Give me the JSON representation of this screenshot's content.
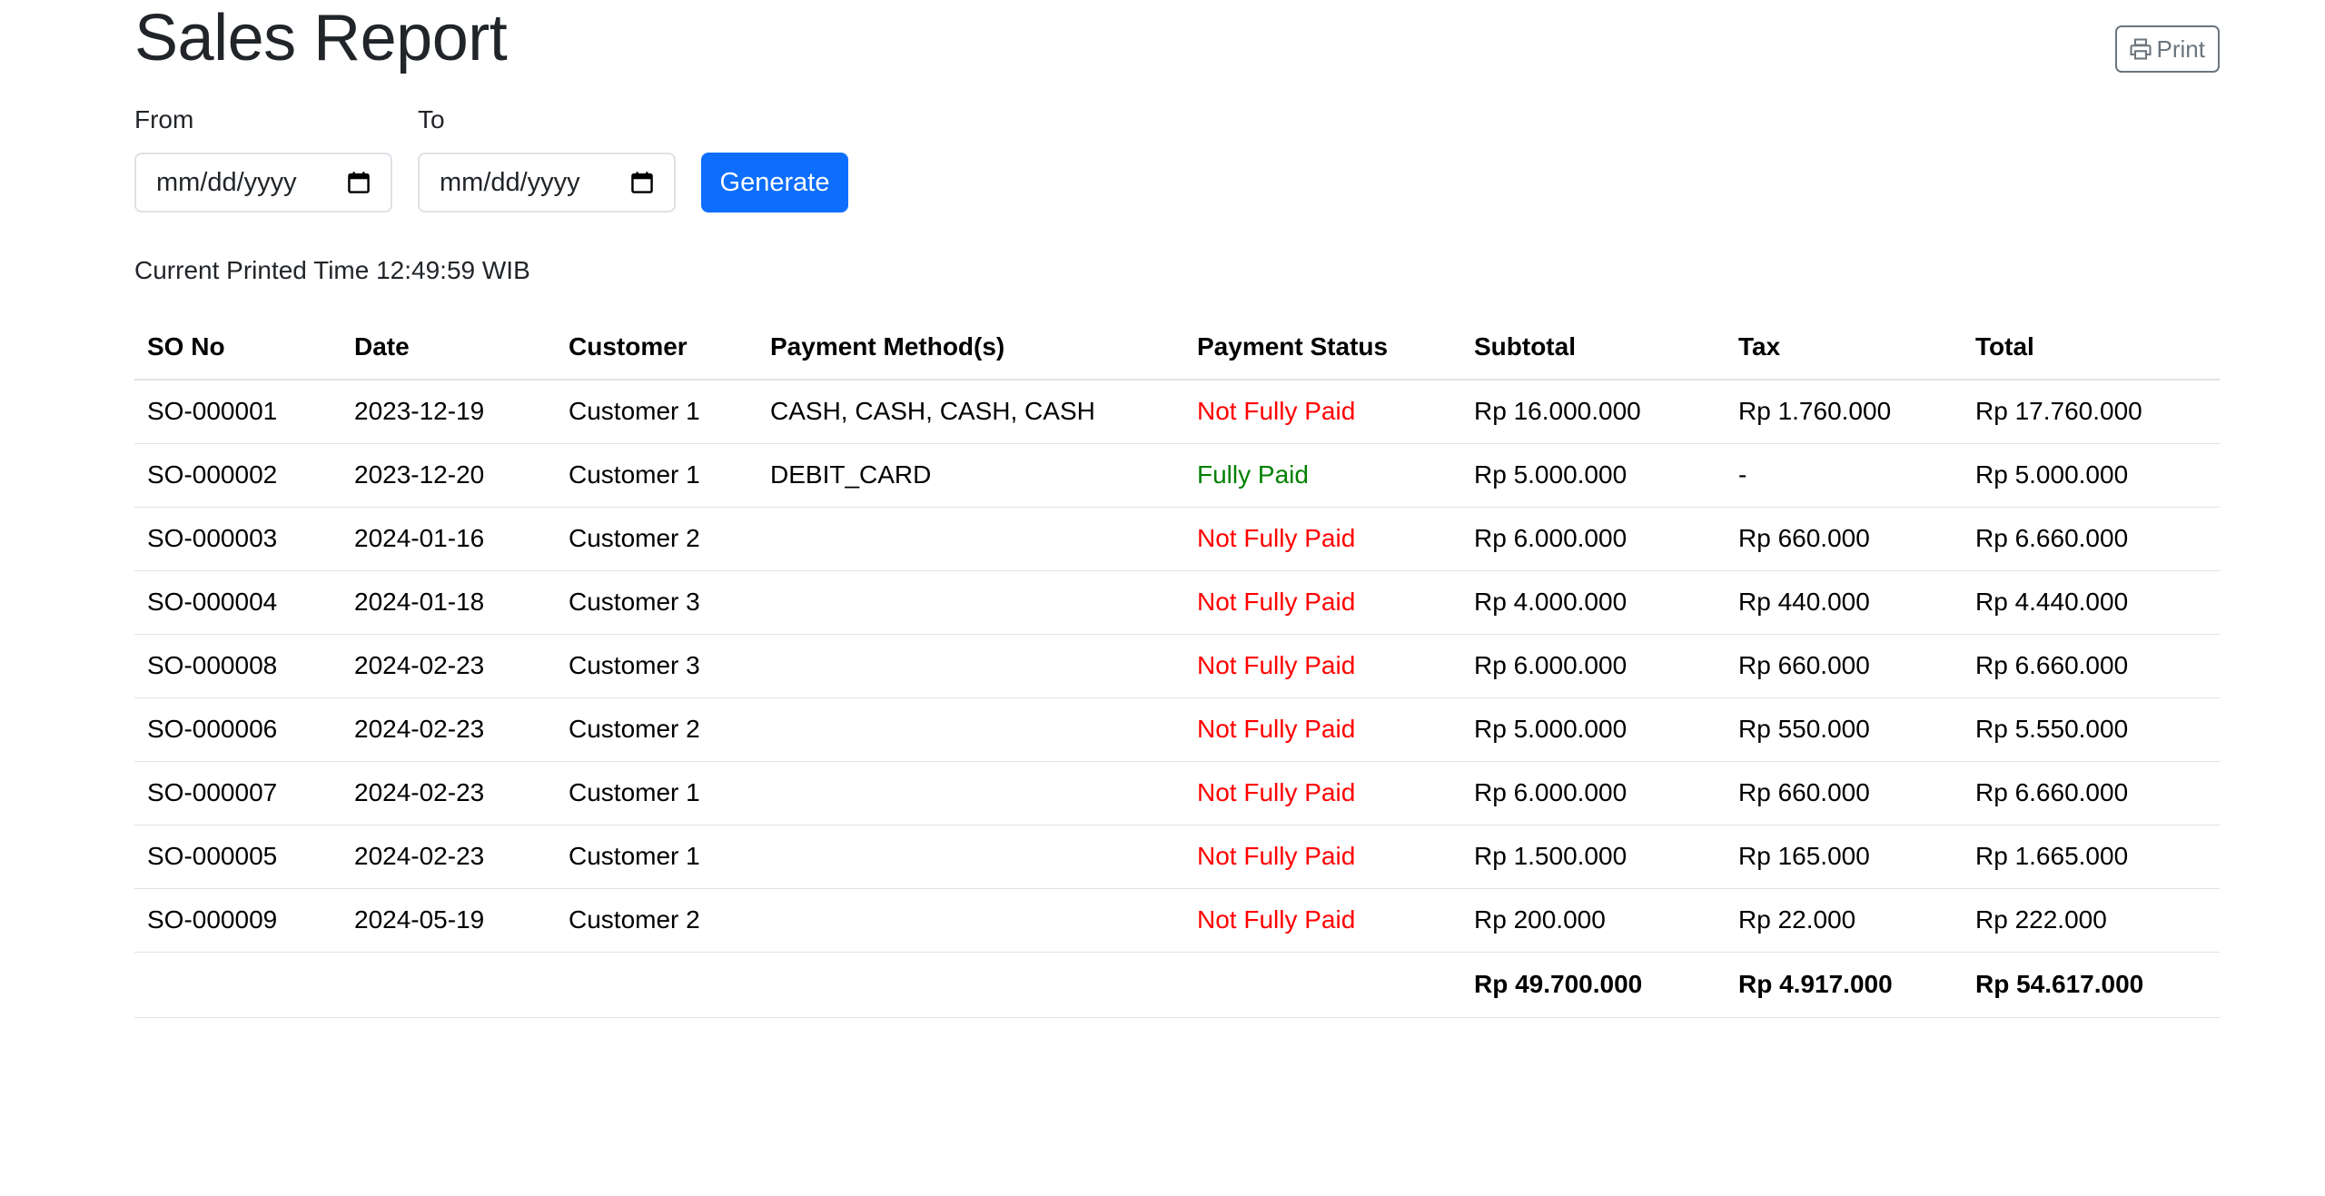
{
  "page": {
    "title": "Sales Report",
    "print_label": "Print"
  },
  "filters": {
    "from_label": "From",
    "to_label": "To",
    "from_placeholder": "mm/dd/yyyy",
    "to_placeholder": "mm/dd/yyyy",
    "generate_label": "Generate"
  },
  "printed_time": "Current Printed Time 12:49:59 WIB",
  "colors": {
    "primary": "#0d6efd",
    "not_fully_paid": "#ff0000",
    "fully_paid": "#008000",
    "secondary": "#6c757d"
  },
  "table": {
    "headers": [
      "SO No",
      "Date",
      "Customer",
      "Payment Method(s)",
      "Payment Status",
      "Subtotal",
      "Tax",
      "Total"
    ],
    "rows": [
      {
        "so_no": "SO-000001",
        "date": "2023-12-19",
        "customer": "Customer 1",
        "payment_methods": "CASH, CASH, CASH, CASH",
        "status": "Not Fully Paid",
        "subtotal": "Rp 16.000.000",
        "tax": "Rp 1.760.000",
        "total": "Rp 17.760.000"
      },
      {
        "so_no": "SO-000002",
        "date": "2023-12-20",
        "customer": "Customer 1",
        "payment_methods": "DEBIT_CARD",
        "status": "Fully Paid",
        "subtotal": "Rp 5.000.000",
        "tax": "-",
        "total": "Rp 5.000.000"
      },
      {
        "so_no": "SO-000003",
        "date": "2024-01-16",
        "customer": "Customer 2",
        "payment_methods": "",
        "status": "Not Fully Paid",
        "subtotal": "Rp 6.000.000",
        "tax": "Rp 660.000",
        "total": "Rp 6.660.000"
      },
      {
        "so_no": "SO-000004",
        "date": "2024-01-18",
        "customer": "Customer 3",
        "payment_methods": "",
        "status": "Not Fully Paid",
        "subtotal": "Rp 4.000.000",
        "tax": "Rp 440.000",
        "total": "Rp 4.440.000"
      },
      {
        "so_no": "SO-000008",
        "date": "2024-02-23",
        "customer": "Customer 3",
        "payment_methods": "",
        "status": "Not Fully Paid",
        "subtotal": "Rp 6.000.000",
        "tax": "Rp 660.000",
        "total": "Rp 6.660.000"
      },
      {
        "so_no": "SO-000006",
        "date": "2024-02-23",
        "customer": "Customer 2",
        "payment_methods": "",
        "status": "Not Fully Paid",
        "subtotal": "Rp 5.000.000",
        "tax": "Rp 550.000",
        "total": "Rp 5.550.000"
      },
      {
        "so_no": "SO-000007",
        "date": "2024-02-23",
        "customer": "Customer 1",
        "payment_methods": "",
        "status": "Not Fully Paid",
        "subtotal": "Rp 6.000.000",
        "tax": "Rp 660.000",
        "total": "Rp 6.660.000"
      },
      {
        "so_no": "SO-000005",
        "date": "2024-02-23",
        "customer": "Customer 1",
        "payment_methods": "",
        "status": "Not Fully Paid",
        "subtotal": "Rp 1.500.000",
        "tax": "Rp 165.000",
        "total": "Rp 1.665.000"
      },
      {
        "so_no": "SO-000009",
        "date": "2024-05-19",
        "customer": "Customer 2",
        "payment_methods": "",
        "status": "Not Fully Paid",
        "subtotal": "Rp 200.000",
        "tax": "Rp 22.000",
        "total": "Rp 222.000"
      }
    ],
    "totals": {
      "subtotal": "Rp 49.700.000",
      "tax": "Rp 4.917.000",
      "total": "Rp 54.617.000"
    }
  }
}
